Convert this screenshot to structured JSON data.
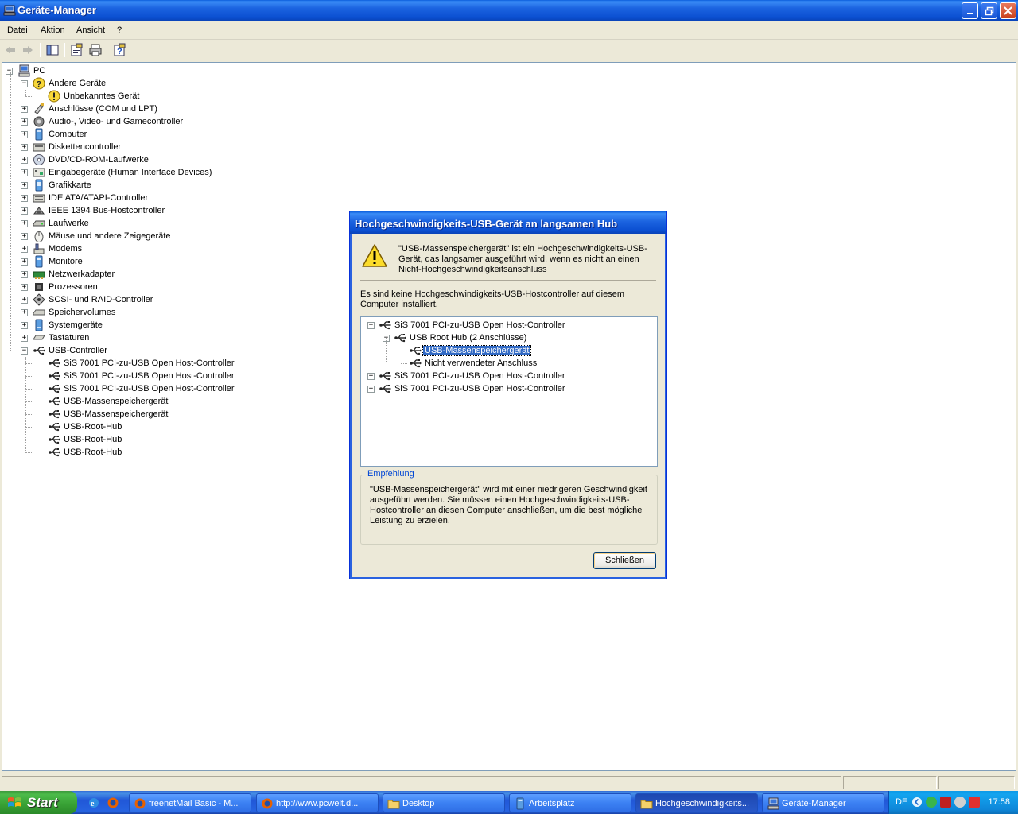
{
  "window": {
    "title": "Geräte-Manager",
    "menu": [
      "Datei",
      "Aktion",
      "Ansicht",
      "?"
    ]
  },
  "tree": {
    "root": "PC",
    "categories": [
      {
        "label": "Andere Geräte",
        "expanded": true,
        "children": [
          "Unbekanntes Gerät"
        ]
      },
      {
        "label": "Anschlüsse (COM und LPT)"
      },
      {
        "label": "Audio-, Video- und Gamecontroller"
      },
      {
        "label": "Computer"
      },
      {
        "label": "Diskettencontroller"
      },
      {
        "label": "DVD/CD-ROM-Laufwerke"
      },
      {
        "label": "Eingabegeräte (Human Interface Devices)"
      },
      {
        "label": "Grafikkarte"
      },
      {
        "label": "IDE ATA/ATAPI-Controller"
      },
      {
        "label": "IEEE 1394 Bus-Hostcontroller"
      },
      {
        "label": "Laufwerke"
      },
      {
        "label": "Mäuse und andere Zeigegeräte"
      },
      {
        "label": "Modems"
      },
      {
        "label": "Monitore"
      },
      {
        "label": "Netzwerkadapter"
      },
      {
        "label": "Prozessoren"
      },
      {
        "label": "SCSI- und RAID-Controller"
      },
      {
        "label": "Speichervolumes"
      },
      {
        "label": "Systemgeräte"
      },
      {
        "label": "Tastaturen"
      },
      {
        "label": "USB-Controller",
        "expanded": true,
        "children": [
          "SiS 7001 PCI-zu-USB Open Host-Controller",
          "SiS 7001 PCI-zu-USB Open Host-Controller",
          "SiS 7001 PCI-zu-USB Open Host-Controller",
          "USB-Massenspeichergerät",
          "USB-Massenspeichergerät",
          "USB-Root-Hub",
          "USB-Root-Hub",
          "USB-Root-Hub"
        ]
      }
    ]
  },
  "dialog": {
    "title": "Hochgeschwindigkeits-USB-Gerät an langsamen Hub",
    "message": "\"USB-Massenspeichergerät\" ist ein Hochgeschwindigkeits-USB-Gerät, das langsamer ausgeführt wird, wenn es nicht an einen Nicht-Hochgeschwindigkeitsanschluss",
    "info": "Es sind keine Hochgeschwindigkeits-USB-Hostcontroller auf diesem Computer installiert.",
    "tree": [
      {
        "label": "SiS 7001 PCI-zu-USB Open Host-Controller",
        "level": 0,
        "expander": "-"
      },
      {
        "label": "USB Root Hub (2 Anschlüsse)",
        "level": 1,
        "expander": "-"
      },
      {
        "label": "USB-Massenspeichergerät",
        "level": 2,
        "selected": true
      },
      {
        "label": "Nicht verwendeter Anschluss",
        "level": 2
      },
      {
        "label": "SiS 7001 PCI-zu-USB Open Host-Controller",
        "level": 0,
        "expander": "+"
      },
      {
        "label": "SiS 7001 PCI-zu-USB Open Host-Controller",
        "level": 0,
        "expander": "+"
      }
    ],
    "group_label": "Empfehlung",
    "recommendation": "\"USB-Massenspeichergerät\" wird mit einer niedrigeren Geschwindigkeit ausgeführt werden. Sie müssen einen Hochgeschwindigkeits-USB-Hostcontroller an diesen Computer anschließen, um die best mögliche Leistung zu erzielen.",
    "close_label": "Schließen"
  },
  "taskbar": {
    "start_label": "Start",
    "tasks": [
      {
        "label": "freenetMail Basic - M...",
        "active": false
      },
      {
        "label": "http://www.pcwelt.d...",
        "active": false
      },
      {
        "label": "Desktop",
        "active": false
      },
      {
        "label": "Arbeitsplatz",
        "active": false
      },
      {
        "label": "Hochgeschwindigkeits...",
        "active": true
      },
      {
        "label": "Geräte-Manager",
        "active": false
      }
    ],
    "language": "DE",
    "clock": "17:58"
  },
  "colors": {
    "selection": "#316ac5",
    "titlebar": "#0b4fd1",
    "start_green": "#37a034",
    "legend_blue": "#0046d5"
  }
}
